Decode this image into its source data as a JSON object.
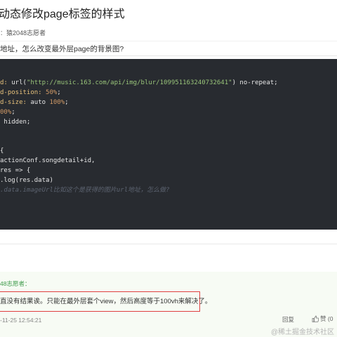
{
  "question": {
    "title": "动态修改page标签的样式",
    "meta_prefix": "：",
    "author": "猿2048志愿者",
    "body": "地址，怎么改变最外层page的背景图?"
  },
  "code_lines": [
    [
      {
        "t": "d: ",
        "c": "prop"
      },
      {
        "t": "url(",
        "c": "kw"
      },
      {
        "t": "\"http://music.163.com/api/img/blur/109951163240732641\"",
        "c": "str"
      },
      {
        "t": ") no-repeat;",
        "c": "kw"
      }
    ],
    [
      {
        "t": "d-position: ",
        "c": "prop"
      },
      {
        "t": "50%",
        "c": "num"
      },
      {
        "t": ";",
        "c": "kw"
      }
    ],
    [
      {
        "t": "d-size: ",
        "c": "prop"
      },
      {
        "t": "auto ",
        "c": "kw"
      },
      {
        "t": "100%",
        "c": "num"
      },
      {
        "t": ";",
        "c": "kw"
      }
    ],
    [
      {
        "t": "00%",
        "c": "num"
      },
      {
        "t": ";",
        "c": "kw"
      }
    ],
    [
      {
        "t": " hidden;",
        "c": "kw"
      }
    ],
    [],
    [],
    [
      {
        "t": "{",
        "c": "kw"
      }
    ],
    [
      {
        "t": "actionConf.songdetail+id,",
        "c": "kw"
      }
    ],
    [
      {
        "t": "res => {",
        "c": "kw"
      }
    ],
    [
      {
        "t": ".log(res.data)",
        "c": "kw"
      }
    ],
    [
      {
        "t": ".data.imageUrl比如这个是获得的图片url地址，怎么做?",
        "c": "comment"
      }
    ]
  ],
  "answer": {
    "author": "48志愿者：",
    "text": "直没有结果诶。只能在最外层套个view，然后高度等于100vh来解决了。",
    "time": "-11-25 12:54:21",
    "reply_label": "回复",
    "like_label": "赞 (0"
  },
  "watermark": "@稀土掘金技术社区",
  "colors": {
    "code_bg": "#282b30",
    "answer_bg": "#f7fbf4",
    "highlight_border": "#e04040",
    "author_green": "#3e9a4a"
  }
}
